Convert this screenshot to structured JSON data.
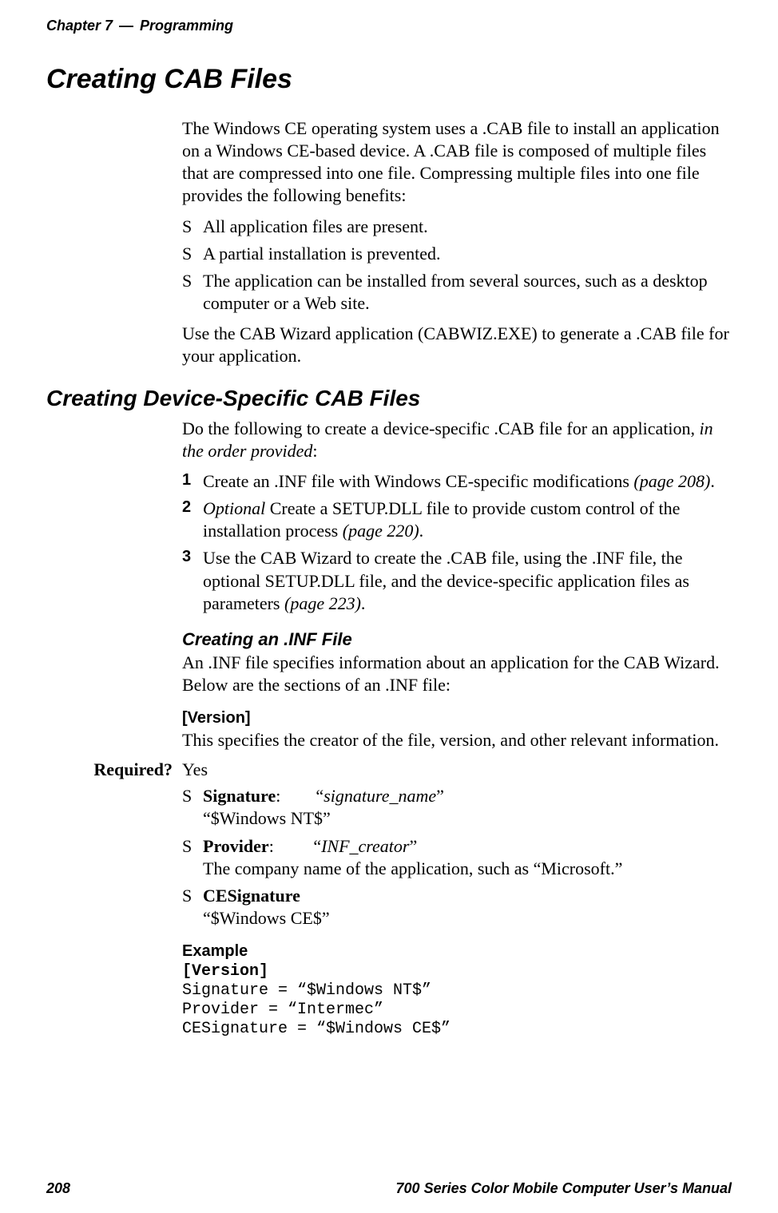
{
  "header": {
    "chapter": "Chapter 7",
    "dash": "—",
    "section": "Programming"
  },
  "footer": {
    "page": "208",
    "manual": "700 Series Color Mobile Computer User’s Manual"
  },
  "h1": "Creating CAB Files",
  "intro": "The Windows CE operating system uses a .CAB file to install an application on a Windows CE-based device. A .CAB file is composed of multiple files that are compressed into one file. Compressing multiple files into one file provides the following benefits:",
  "bullets": [
    "All application files are present.",
    "A partial installation is prevented.",
    "The application can be installed from several sources, such as a desktop computer or a Web site."
  ],
  "after_bullets": "Use the CAB Wizard application (CABWIZ.EXE) to generate a .CAB file for your application.",
  "h2": "Creating Device-Specific CAB Files",
  "dev_intro_pre": "Do the following to create a device-specific .CAB file for an application, ",
  "dev_intro_ital": "in the order provided",
  "dev_intro_post": ":",
  "steps": [
    {
      "pre": "Create an .INF file with Windows CE-specific modifications ",
      "page_ref": "(page 208)",
      "post": "."
    },
    {
      "opt": "Optional",
      "mid": " Create a SETUP.DLL file to provide custom control of the installation process ",
      "page_ref": "(page 220)",
      "post": "."
    },
    {
      "pre": "Use the CAB Wizard to create the .CAB file, using the .INF file, the optional SETUP.DLL file, and the device-specific application files as parameters ",
      "page_ref": "(page 223)",
      "post": "."
    }
  ],
  "h3_inf": "Creating an .INF File",
  "inf_desc": "An .INF file specifies information about an application for the CAB Wizard. Below are the sections of an .INF file:",
  "h4_version": "[Version]",
  "version_desc": "This specifies the creator of the file, version, and other relevant information.",
  "required_label": "Required?",
  "required_value": "Yes",
  "fields": [
    {
      "name": "Signature",
      "sep": ":",
      "quote_open": "“",
      "ital": "signature_name",
      "quote_close": "”",
      "sub": "“$Windows NT$”"
    },
    {
      "name": "Provider",
      "sep": ":",
      "quote_open": "“",
      "ital": "INF_creator",
      "quote_close": "”",
      "sub": "The company name of the application, such as “Microsoft.”"
    },
    {
      "name": "CESignature",
      "sub": "“$Windows CE$”"
    }
  ],
  "h4_example": "Example",
  "example_code": {
    "l1": "[Version]",
    "l2": "Signature = “$Windows NT$”",
    "l3": "Provider = “Intermec”",
    "l4": "CESignature = “$Windows CE$”"
  }
}
